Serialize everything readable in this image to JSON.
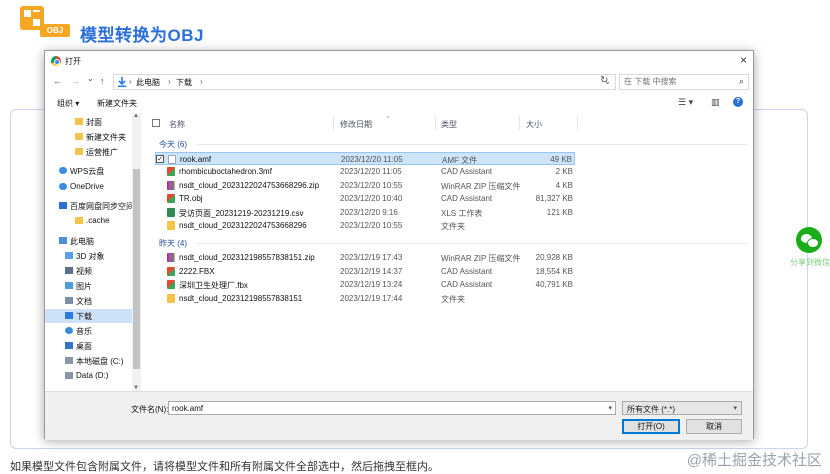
{
  "page": {
    "logo_tag": "OBJ",
    "title": "模型转换为OBJ",
    "hint": "如果模型文件包含附属文件，请将模型文件和所有附属文件全部选中，然后拖拽至框内。",
    "watermark": "@稀土掘金技术社区",
    "wechat_label": "分享到微信"
  },
  "dialog": {
    "title": "打开",
    "close": "×",
    "nav": {
      "back": "←",
      "forward": "→",
      "history": "⌄",
      "up": "↑",
      "breadcrumb": [
        "此电脑",
        "下载"
      ],
      "refresh": "↻",
      "search_placeholder": "在 下载 中搜索"
    },
    "toolbar": {
      "organize": "组织 ▾",
      "new_folder": "新建文件夹"
    },
    "sidebar": [
      {
        "label": "封面",
        "icon": "folder-icon"
      },
      {
        "label": "新建文件夹",
        "icon": "folder-icon"
      },
      {
        "label": "运营推广",
        "icon": "folder-icon"
      },
      {
        "label": "WPS云盘",
        "icon": "cloud-icon"
      },
      {
        "label": "OneDrive",
        "icon": "cloud-icon"
      },
      {
        "label": "百度网盘同步空间",
        "icon": "cloud-drive-icon"
      },
      {
        "label": ".cache",
        "icon": "folder-icon"
      },
      {
        "label": "此电脑",
        "icon": "computer-icon"
      },
      {
        "label": "3D 对象",
        "icon": "3d-objects-icon"
      },
      {
        "label": "视频",
        "icon": "video-icon"
      },
      {
        "label": "图片",
        "icon": "pictures-icon"
      },
      {
        "label": "文档",
        "icon": "documents-icon"
      },
      {
        "label": "下载",
        "icon": "download-icon"
      },
      {
        "label": "音乐",
        "icon": "music-icon"
      },
      {
        "label": "桌面",
        "icon": "desktop-icon"
      },
      {
        "label": "本地磁盘 (C:)",
        "icon": "drive-icon"
      },
      {
        "label": "Data (D:)",
        "icon": "drive-icon"
      }
    ],
    "columns": {
      "name": "名称",
      "date": "修改日期",
      "type": "类型",
      "size": "大小"
    },
    "groups": [
      {
        "label": "今天 (6)",
        "files": [
          {
            "name": "rook.amf",
            "date": "2023/12/20 11:05",
            "type": "AMF 文件",
            "size": "49 KB",
            "icon": "file-icon"
          },
          {
            "name": "rhombicuboctahedron.3mf",
            "date": "2023/12/20 11:05",
            "type": "CAD Assistant",
            "size": "2 KB",
            "icon": "cad-file-icon"
          },
          {
            "name": "nsdt_cloud_20231220247536682​96.zip",
            "date": "2023/12/20 10:55",
            "type": "WinRAR ZIP 压缩文件",
            "size": "4 KB",
            "icon": "zip-icon"
          },
          {
            "name": "TR.obj",
            "date": "2023/12/20 10:40",
            "type": "CAD Assistant",
            "size": "81,327 KB",
            "icon": "cad-file-icon"
          },
          {
            "name": "受访页面_20231219-20231219.csv",
            "date": "2023/12/20 9:16",
            "type": "XLS 工作表",
            "size": "121 KB",
            "icon": "spreadsheet-icon"
          },
          {
            "name": "nsdt_cloud_202312202475366829​6",
            "date": "2023/12/20 10:55",
            "type": "文件夹",
            "size": "",
            "icon": "folder-icon"
          }
        ]
      },
      {
        "label": "昨天 (4)",
        "files": [
          {
            "name": "nsdt_cloud_202312198557838151.zip",
            "date": "2023/12/19 17:43",
            "type": "WinRAR ZIP 压缩文件",
            "size": "20,928 KB",
            "icon": "zip-icon"
          },
          {
            "name": "2222.FBX",
            "date": "2023/12/19 14:37",
            "type": "CAD Assistant",
            "size": "18,554 KB",
            "icon": "cad-file-icon"
          },
          {
            "name": "深圳卫生处理厂.fbx",
            "date": "2023/12/19 13:24",
            "type": "CAD Assistant",
            "size": "40,791 KB",
            "icon": "cad-file-icon"
          },
          {
            "name": "nsdt_cloud_202312198557838151",
            "date": "2023/12/19 17:44",
            "type": "文件夹",
            "size": "",
            "icon": "folder-icon"
          }
        ]
      }
    ],
    "footer": {
      "filename_label": "文件名(N):",
      "filename_value": "rook.amf",
      "filetype": "所有文件 (*.*)",
      "open": "打开(O)",
      "cancel": "取消"
    }
  },
  "colors": {
    "accent": "#2b6fdb",
    "logo": "#f5a623",
    "selection": "#cde4f9",
    "wechat": "#1aad19"
  }
}
